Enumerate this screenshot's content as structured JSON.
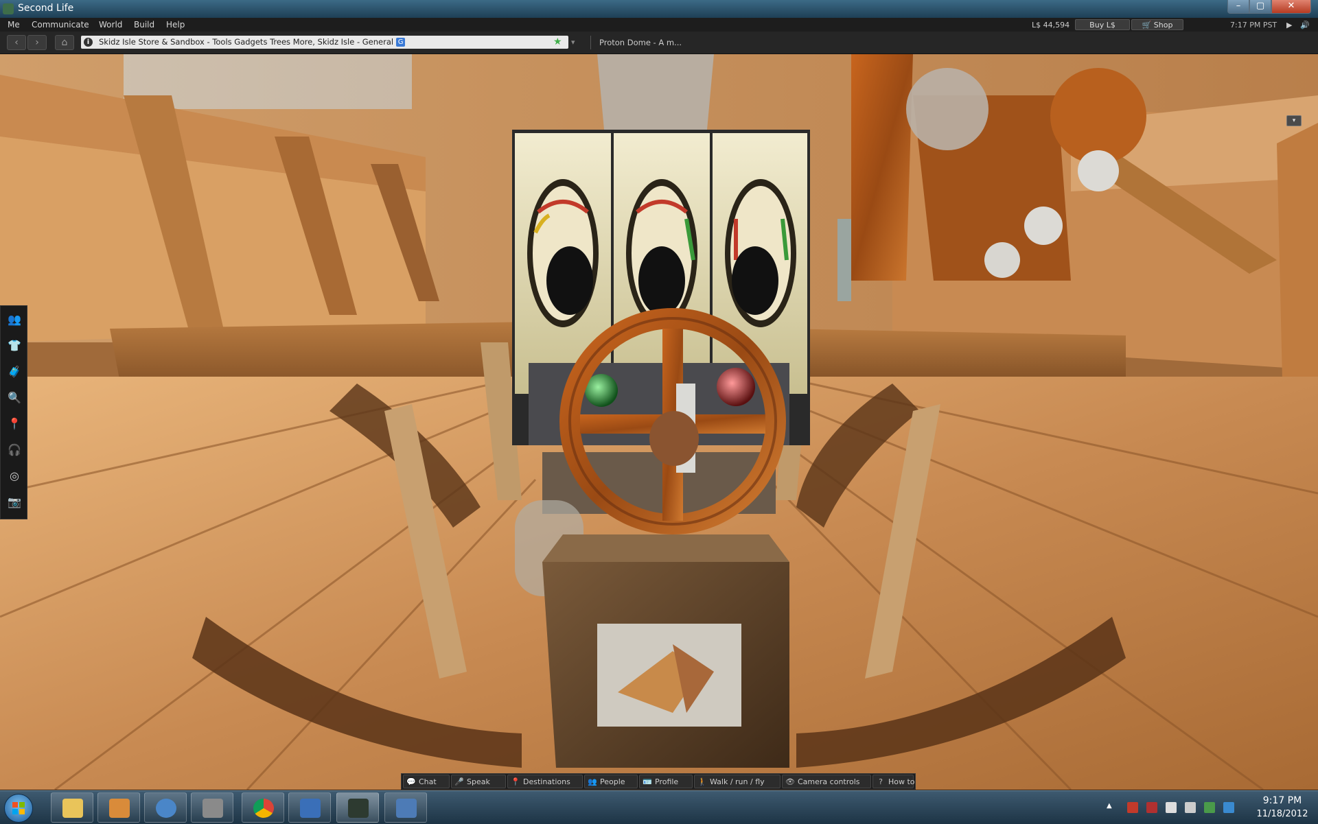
{
  "window": {
    "title": "Second Life",
    "controls": {
      "minimize": "–",
      "maximize": "▢",
      "close": "✕"
    }
  },
  "menubar": {
    "items": [
      "Me",
      "Communicate",
      "World",
      "Build",
      "Help"
    ],
    "balance": "L$ 44,594",
    "buy_label": "Buy L$",
    "shop_label": "Shop",
    "time": "7:17 PM PST"
  },
  "navbar": {
    "back": "‹",
    "forward": "›",
    "home": "⌂",
    "location": "Skidz Isle Store & Sandbox - Tools Gadgets Trees More, Skidz Isle - General",
    "maturity_badge": "G",
    "favorite_icon": "star-icon",
    "search_text": "Proton Dome - A m..."
  },
  "world": {
    "scene": "wooden-deck-with-gauge-panel-and-valve-wheel",
    "minimize_btn": "▾"
  },
  "sidebar": {
    "items": [
      {
        "name": "people",
        "glyph": "👥"
      },
      {
        "name": "appearance",
        "glyph": "👕"
      },
      {
        "name": "inventory",
        "glyph": "🧳"
      },
      {
        "name": "search",
        "glyph": "🔍"
      },
      {
        "name": "places",
        "glyph": "📍"
      },
      {
        "name": "voice",
        "glyph": "🎧"
      },
      {
        "name": "radar",
        "glyph": "◎"
      },
      {
        "name": "snapshot",
        "glyph": "📷"
      }
    ]
  },
  "bottombar": {
    "buttons": [
      {
        "label": "Chat",
        "icon": "💬"
      },
      {
        "label": "Speak",
        "icon": "🎤"
      },
      {
        "label": "Destinations",
        "icon": "📍"
      },
      {
        "label": "People",
        "icon": "👥"
      },
      {
        "label": "Profile",
        "icon": "🪪"
      },
      {
        "label": "Walk / run / fly",
        "icon": "🚶"
      },
      {
        "label": "Camera controls",
        "icon": "👁"
      },
      {
        "label": "How to",
        "icon": "?"
      }
    ]
  },
  "taskbar": {
    "apps": [
      {
        "name": "explorer",
        "color": "#e9c45a"
      },
      {
        "name": "paint",
        "color": "#d98b3a"
      },
      {
        "name": "thunderbird",
        "color": "#4a86c8"
      },
      {
        "name": "gimp",
        "color": "#8a8a8a"
      },
      {
        "name": "chrome",
        "color": "#db4437"
      },
      {
        "name": "remote-desktop",
        "color": "#3a6fb8"
      },
      {
        "name": "second-life",
        "color": "#5aa86a"
      },
      {
        "name": "window",
        "color": "#4d7bb6"
      }
    ],
    "time": "9:17 PM",
    "date": "11/18/2012"
  },
  "colors": {
    "wood_light": "#d9a064",
    "wood_dark": "#8a5428",
    "rust": "#b05a1a",
    "gauge_face": "#e8e0c0"
  }
}
